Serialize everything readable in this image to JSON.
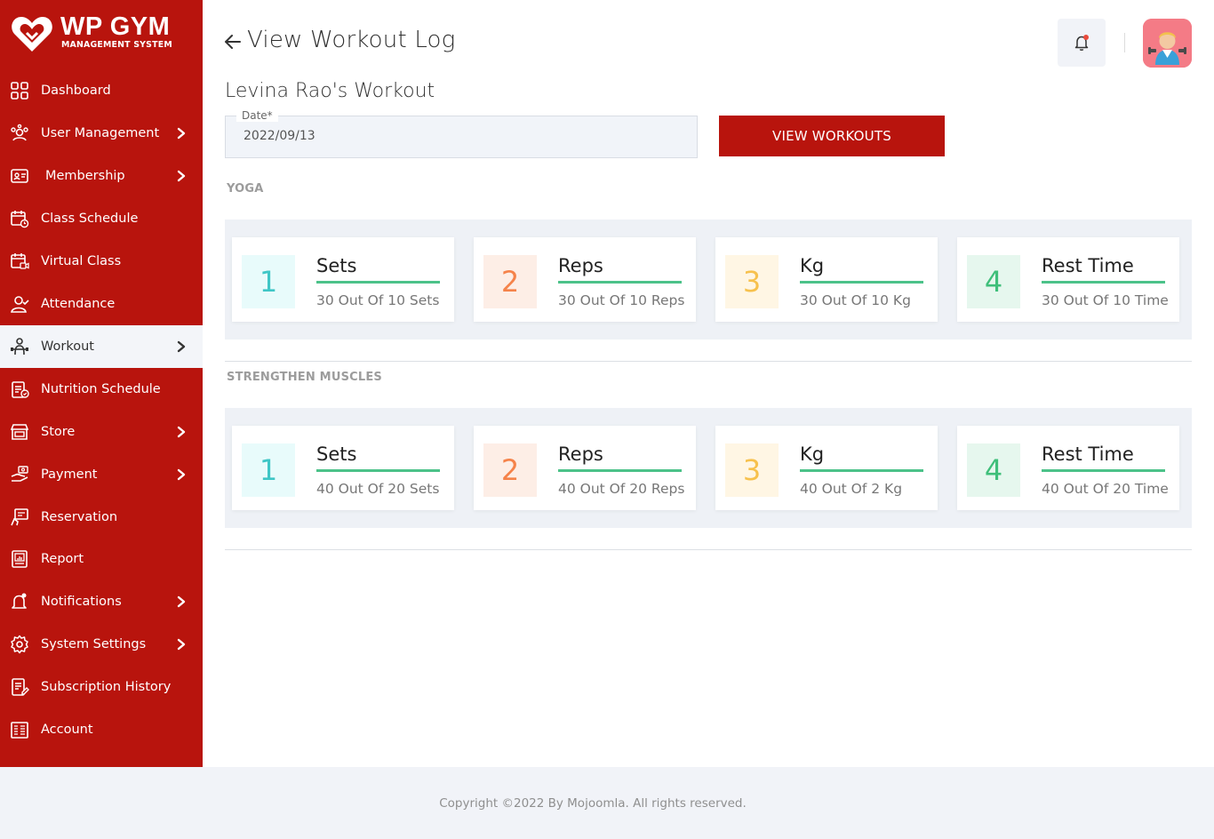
{
  "brand": {
    "title": "WP GYM",
    "subtitle": "MANAGEMENT SYSTEM"
  },
  "sidebar": {
    "items": [
      {
        "label": "Dashboard",
        "icon": "dashboard-icon",
        "has_submenu": false,
        "active": false
      },
      {
        "label": "User Management",
        "icon": "users-icon",
        "has_submenu": true,
        "active": false
      },
      {
        "label": "Membership",
        "icon": "membership-card-icon",
        "has_submenu": true,
        "active": false
      },
      {
        "label": "Class Schedule",
        "icon": "calendar-icon",
        "has_submenu": false,
        "active": false
      },
      {
        "label": "Virtual Class",
        "icon": "calendar-video-icon",
        "has_submenu": false,
        "active": false
      },
      {
        "label": "Attendance",
        "icon": "user-check-icon",
        "has_submenu": false,
        "active": false
      },
      {
        "label": "Workout",
        "icon": "workout-icon",
        "has_submenu": true,
        "active": true
      },
      {
        "label": "Nutrition Schedule",
        "icon": "nutrition-icon",
        "has_submenu": false,
        "active": false
      },
      {
        "label": "Store",
        "icon": "store-icon",
        "has_submenu": true,
        "active": false
      },
      {
        "label": "Payment",
        "icon": "payment-icon",
        "has_submenu": true,
        "active": false
      },
      {
        "label": "Reservation",
        "icon": "reservation-icon",
        "has_submenu": false,
        "active": false
      },
      {
        "label": "Report",
        "icon": "report-icon",
        "has_submenu": false,
        "active": false
      },
      {
        "label": "Notifications",
        "icon": "bell-icon",
        "has_submenu": true,
        "active": false
      },
      {
        "label": "System Settings",
        "icon": "gear-icon",
        "has_submenu": true,
        "active": false
      },
      {
        "label": "Subscription History",
        "icon": "subscription-icon",
        "has_submenu": false,
        "active": false
      },
      {
        "label": "Account",
        "icon": "account-icon",
        "has_submenu": false,
        "active": false
      }
    ]
  },
  "header": {
    "title": "View Workout Log",
    "notification_dot": true
  },
  "main": {
    "heading": "Levina Rao's Workout",
    "date_field": {
      "label": "Date*",
      "value": "2022/09/13"
    },
    "view_button_label": "VIEW WORKOUTS",
    "workouts": [
      {
        "name": "YOGA",
        "cards": [
          {
            "num": "1",
            "title": "Sets",
            "detail": "30 Out Of 10 Sets"
          },
          {
            "num": "2",
            "title": "Reps",
            "detail": "30 Out Of 10 Reps"
          },
          {
            "num": "3",
            "title": "Kg",
            "detail": "30 Out Of 10 Kg"
          },
          {
            "num": "4",
            "title": "Rest Time",
            "detail": "30 Out Of 10 Time"
          }
        ]
      },
      {
        "name": "STRENGTHEN MUSCLES",
        "cards": [
          {
            "num": "1",
            "title": "Sets",
            "detail": "40 Out Of 20 Sets"
          },
          {
            "num": "2",
            "title": "Reps",
            "detail": "40 Out Of 20 Reps"
          },
          {
            "num": "3",
            "title": "Kg",
            "detail": "40 Out Of 2 Kg"
          },
          {
            "num": "4",
            "title": "Rest Time",
            "detail": "40 Out Of 20 Time"
          }
        ]
      }
    ]
  },
  "footer": {
    "copyright": "Copyright ©2022 By Mojoomla. All rights reserved."
  },
  "colors": {
    "brand_red": "#b8140d",
    "accent_green": "#4cc289",
    "panel_bg": "#eef1f6"
  }
}
